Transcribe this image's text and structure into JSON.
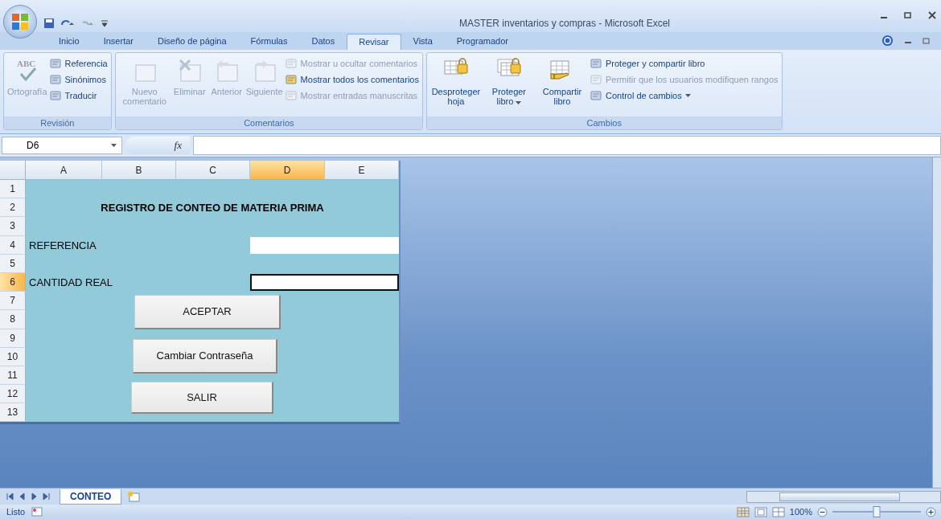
{
  "window": {
    "title": "MASTER inventarios y compras - Microsoft Excel"
  },
  "ribbon": {
    "tabs": [
      {
        "label": "Inicio",
        "selected": false
      },
      {
        "label": "Insertar",
        "selected": false
      },
      {
        "label": "Diseño de página",
        "selected": false
      },
      {
        "label": "Fórmulas",
        "selected": false
      },
      {
        "label": "Datos",
        "selected": false
      },
      {
        "label": "Revisar",
        "selected": true
      },
      {
        "label": "Vista",
        "selected": false
      },
      {
        "label": "Programador",
        "selected": false
      }
    ],
    "groups": [
      {
        "label": "Revisión",
        "items": [
          {
            "kind": "large",
            "label": "Ortografía",
            "disabled": true,
            "icon_text": "ABC"
          },
          {
            "kind": "small",
            "label": "Referencia",
            "disabled": false
          },
          {
            "kind": "small",
            "label": "Sinónimos",
            "disabled": false
          },
          {
            "kind": "small",
            "label": "Traducir",
            "disabled": false
          }
        ]
      },
      {
        "label": "Comentarios",
        "items": [
          {
            "kind": "large",
            "label": "Nuevo comentario",
            "disabled": true
          },
          {
            "kind": "large",
            "label": "Eliminar",
            "disabled": true
          },
          {
            "kind": "large",
            "label": "Anterior",
            "disabled": true
          },
          {
            "kind": "large",
            "label": "Siguiente",
            "disabled": true
          },
          {
            "kind": "small",
            "label": "Mostrar u ocultar comentarios",
            "disabled": true
          },
          {
            "kind": "small",
            "label": "Mostrar todos los comentarios",
            "disabled": false
          },
          {
            "kind": "small",
            "label": "Mostrar entradas manuscritas",
            "disabled": true
          }
        ]
      },
      {
        "label": "Cambios",
        "items": [
          {
            "kind": "large",
            "label": "Desproteger hoja",
            "disabled": false
          },
          {
            "kind": "large",
            "label": "Proteger libro",
            "disabled": false,
            "dropdown": true
          },
          {
            "kind": "large",
            "label": "Compartir libro",
            "disabled": false
          },
          {
            "kind": "small",
            "label": "Proteger y compartir libro",
            "disabled": false
          },
          {
            "kind": "small",
            "label": "Permitir que los usuarios modifiquen rangos",
            "disabled": true
          },
          {
            "kind": "small",
            "label": "Control de cambios",
            "disabled": false,
            "dropdown": true
          }
        ]
      }
    ]
  },
  "formula_bar": {
    "name_box": "D6",
    "fx": "fx"
  },
  "sheet": {
    "columns": [
      {
        "label": "A",
        "selected": false
      },
      {
        "label": "B",
        "selected": false
      },
      {
        "label": "C",
        "selected": false
      },
      {
        "label": "D",
        "selected": true
      },
      {
        "label": "E",
        "selected": false
      }
    ],
    "rows": [
      {
        "label": "1",
        "selected": false
      },
      {
        "label": "2",
        "selected": false
      },
      {
        "label": "3",
        "selected": false
      },
      {
        "label": "4",
        "selected": false
      },
      {
        "label": "5",
        "selected": false
      },
      {
        "label": "6",
        "selected": true
      },
      {
        "label": "7",
        "selected": false
      },
      {
        "label": "8",
        "selected": false
      },
      {
        "label": "9",
        "selected": false
      },
      {
        "label": "10",
        "selected": false
      },
      {
        "label": "11",
        "selected": false
      },
      {
        "label": "12",
        "selected": false
      },
      {
        "label": "13",
        "selected": false
      }
    ],
    "title": "REGISTRO DE CONTEO DE MATERIA PRIMA",
    "fields": [
      {
        "label": "REFERENCIA",
        "selected": false
      },
      {
        "label": "CANTIDAD REAL",
        "selected": true
      }
    ],
    "buttons": [
      "ACEPTAR",
      "Cambiar Contraseña",
      "SALIR"
    ]
  },
  "sheet_tabs": [
    {
      "label": "CONTEO",
      "selected": true
    }
  ],
  "status_bar": {
    "status": "Listo",
    "zoom": "100%",
    "zoom_slider": {
      "level": 0.5
    }
  }
}
